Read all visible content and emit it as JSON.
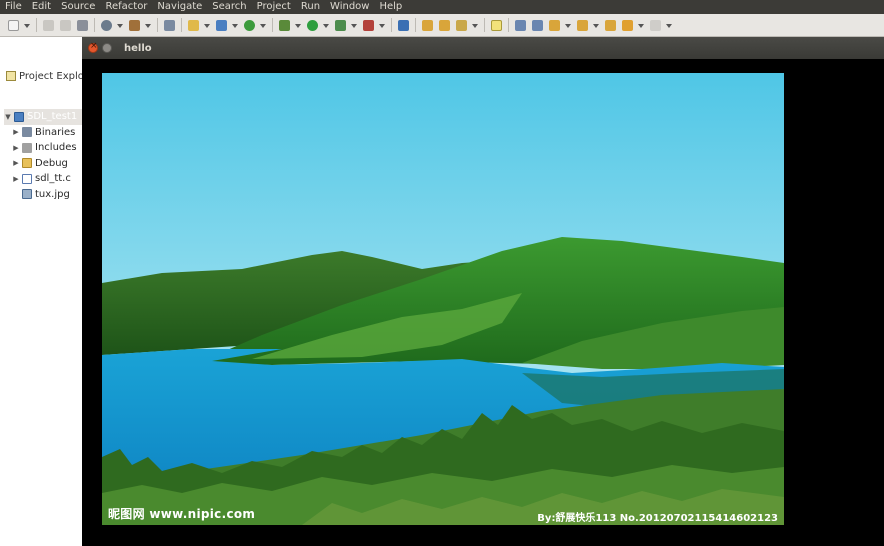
{
  "menubar": {
    "items": [
      "File",
      "Edit",
      "Source",
      "Refactor",
      "Navigate",
      "Search",
      "Project",
      "Run",
      "Window",
      "Help"
    ]
  },
  "explorer": {
    "tab_label": "Project Explo",
    "project": "SDL_test1",
    "items": [
      {
        "label": "Binaries",
        "icon": "binaries-icon"
      },
      {
        "label": "Includes",
        "icon": "includes-icon"
      },
      {
        "label": "Debug",
        "icon": "folder-icon"
      },
      {
        "label": "sdl_tt.c",
        "icon": "c-file-icon"
      },
      {
        "label": "tux.jpg",
        "icon": "image-file-icon"
      }
    ]
  },
  "window": {
    "title": "hello"
  },
  "photo": {
    "watermark_left": "昵图网 www.nipic.com",
    "watermark_right": "By:舒展快乐113  No.20120702115414602123"
  }
}
